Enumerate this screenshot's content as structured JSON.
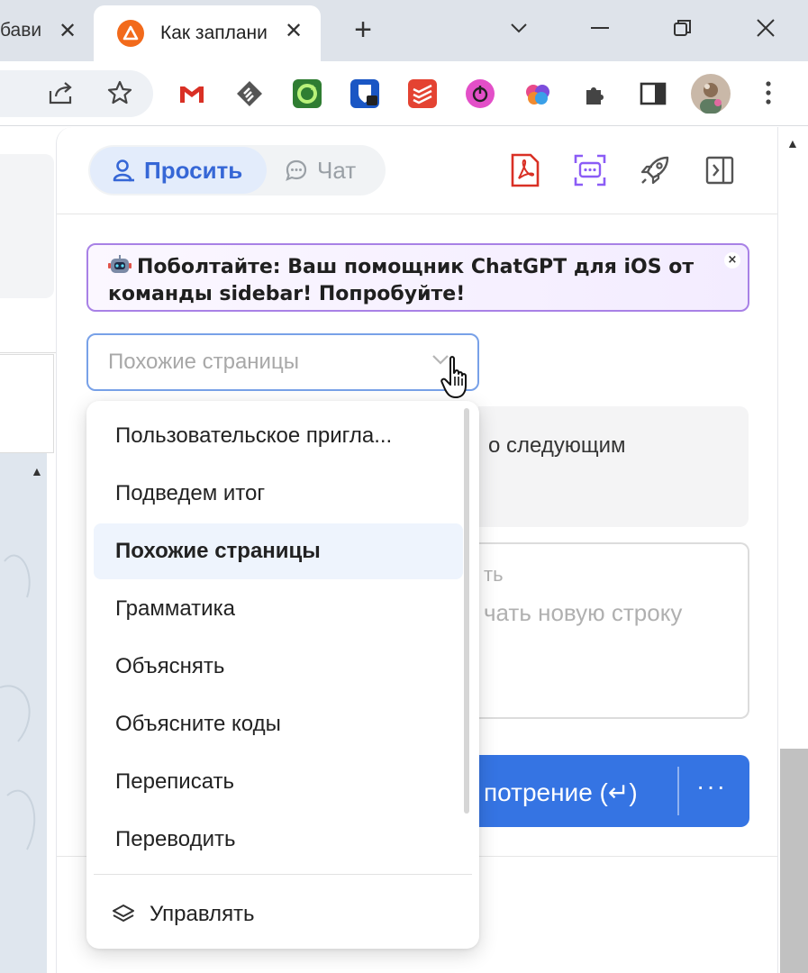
{
  "browser": {
    "tabs": [
      {
        "title": "бави",
        "active": false
      },
      {
        "title": "Как заплани",
        "active": true
      }
    ],
    "new_tab": "+"
  },
  "sidebar": {
    "segment": {
      "ask_label": "Просить",
      "chat_label": "Чат"
    },
    "banner": {
      "text": "Поболтайте: Ваш помощник ChatGPT для iOS от команды sidebar! Попробуйте!",
      "close": "×"
    },
    "select": {
      "value": "Похожие страницы"
    },
    "dropdown": {
      "items": [
        "Пользовательское пригла...",
        "Подведем итог",
        "Похожие страницы",
        "Грамматика",
        "Объяснять",
        "Объясните коды",
        "Переписать",
        "Переводить"
      ],
      "selected_index": 2,
      "manage_label": "Управлять"
    },
    "background": {
      "card_text": "о следующим",
      "input_line1": "ть",
      "input_line2": "чать новую строку",
      "button_text": "потрение (↵)",
      "more": "···"
    }
  },
  "colors": {
    "accent": "#3667d6",
    "button_blue": "#3574e3",
    "banner_border": "#a881e6",
    "select_border": "#78a1e8",
    "pdf_red": "#d93025",
    "ocr_purple": "#8b5cf6"
  },
  "icons": {
    "share": "share-icon",
    "star": "bookmark-star-icon",
    "puzzle": "extensions-icon",
    "side_panel": "side-panel-icon",
    "menu": "kebab-menu-icon"
  }
}
